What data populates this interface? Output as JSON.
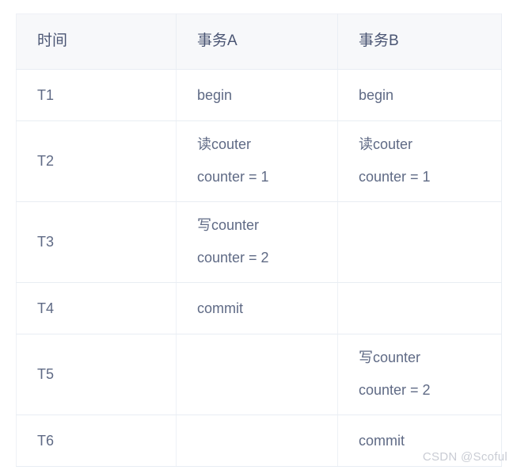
{
  "table": {
    "headers": [
      "时间",
      "事务A",
      "事务B"
    ],
    "rows": [
      {
        "time": "T1",
        "txn_a": [
          "begin"
        ],
        "txn_b": [
          "begin"
        ]
      },
      {
        "time": "T2",
        "txn_a": [
          "读couter",
          "counter = 1"
        ],
        "txn_b": [
          "读couter",
          "counter = 1"
        ]
      },
      {
        "time": "T3",
        "txn_a": [
          "写counter",
          "counter = 2"
        ],
        "txn_b": []
      },
      {
        "time": "T4",
        "txn_a": [
          "commit"
        ],
        "txn_b": []
      },
      {
        "time": "T5",
        "txn_a": [],
        "txn_b": [
          "写counter",
          "counter = 2"
        ]
      },
      {
        "time": "T6",
        "txn_a": [],
        "txn_b": [
          "commit"
        ]
      }
    ]
  },
  "watermark": {
    "text": "CSDN @Scoful"
  },
  "colors": {
    "header_background": "#f7f8fa",
    "header_text": "#4a5573",
    "body_text": "#5f6a85",
    "row_border": "#e8edf3",
    "column_border": "#eef1f6",
    "watermark_text": "#c9ccd4",
    "page_background": "#ffffff"
  }
}
